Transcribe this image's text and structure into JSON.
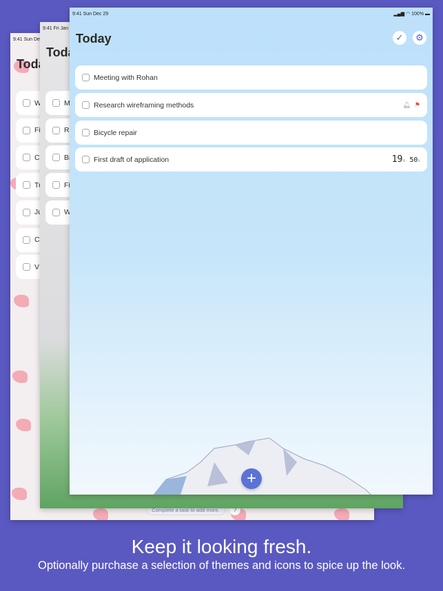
{
  "back_card": {
    "status": "9:41  Sun Dec",
    "title": "Toda",
    "rows": [
      "W",
      "Fi",
      "C",
      "Tr",
      "Ju",
      "C",
      "V"
    ],
    "footer": "Complete a task to add more.",
    "help": "?"
  },
  "middle_card": {
    "status": "9:41  Fri Jan",
    "title": "Toda",
    "rows": [
      "M",
      "Re",
      "Bi",
      "Fi",
      "W"
    ]
  },
  "front_card": {
    "status_time": "9:41  Sun Dec 29",
    "status_right": "100%",
    "title": "Today",
    "tasks": [
      {
        "label": "Meeting with Rohan"
      },
      {
        "label": "Research wireframing methods"
      },
      {
        "label": "Bicycle repair"
      },
      {
        "label": "First draft of application",
        "timer_min": "19",
        "min_unit": "m",
        "timer_sec": "50",
        "sec_unit": "s"
      }
    ],
    "add_label": "+"
  },
  "headline": "Keep it looking fresh.",
  "subheadline": "Optionally purchase a selection of themes and icons to spice up the look.",
  "colors": {
    "background": "#5a59c1",
    "accent": "#4a62d6",
    "flag": "#e8453c"
  }
}
